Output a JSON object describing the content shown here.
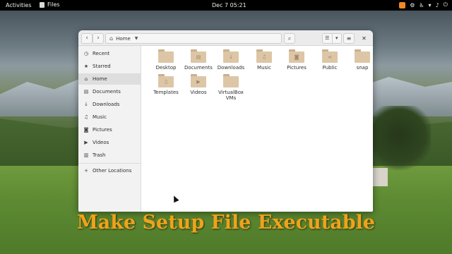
{
  "topbar": {
    "activities_label": "Activities",
    "app_name": "Files",
    "clock": "Dec 7  05:21",
    "tray_icons": [
      "browser-tray-icon",
      "network-status-icon",
      "accessibility-icon",
      "wifi-icon",
      "volume-icon",
      "power-icon"
    ]
  },
  "window": {
    "path_label": "Home",
    "sidebar": [
      {
        "label": "Recent",
        "icon": "clock-icon"
      },
      {
        "label": "Starred",
        "icon": "star-icon"
      },
      {
        "label": "Home",
        "icon": "home-icon",
        "active": true
      },
      {
        "label": "Documents",
        "icon": "document-icon"
      },
      {
        "label": "Downloads",
        "icon": "download-icon"
      },
      {
        "label": "Music",
        "icon": "music-icon"
      },
      {
        "label": "Pictures",
        "icon": "camera-icon"
      },
      {
        "label": "Videos",
        "icon": "video-icon"
      },
      {
        "label": "Trash",
        "icon": "trash-icon"
      },
      {
        "label": "Other Locations",
        "icon": "plus-icon"
      }
    ],
    "folders": [
      {
        "label": "Desktop",
        "icon": "folder-icon"
      },
      {
        "label": "Documents",
        "icon": "folder-document-icon"
      },
      {
        "label": "Downloads",
        "icon": "folder-download-icon"
      },
      {
        "label": "Music",
        "icon": "folder-music-icon"
      },
      {
        "label": "Pictures",
        "icon": "folder-pictures-icon"
      },
      {
        "label": "Public",
        "icon": "folder-share-icon"
      },
      {
        "label": "snap",
        "icon": "folder-icon"
      },
      {
        "label": "Templates",
        "icon": "folder-template-icon"
      },
      {
        "label": "Videos",
        "icon": "folder-video-icon"
      },
      {
        "label": "VirtualBox VMs",
        "icon": "folder-icon"
      }
    ]
  },
  "overlay": {
    "caption": "Make Setup File Executable",
    "caption_color": "#f0a21a"
  }
}
